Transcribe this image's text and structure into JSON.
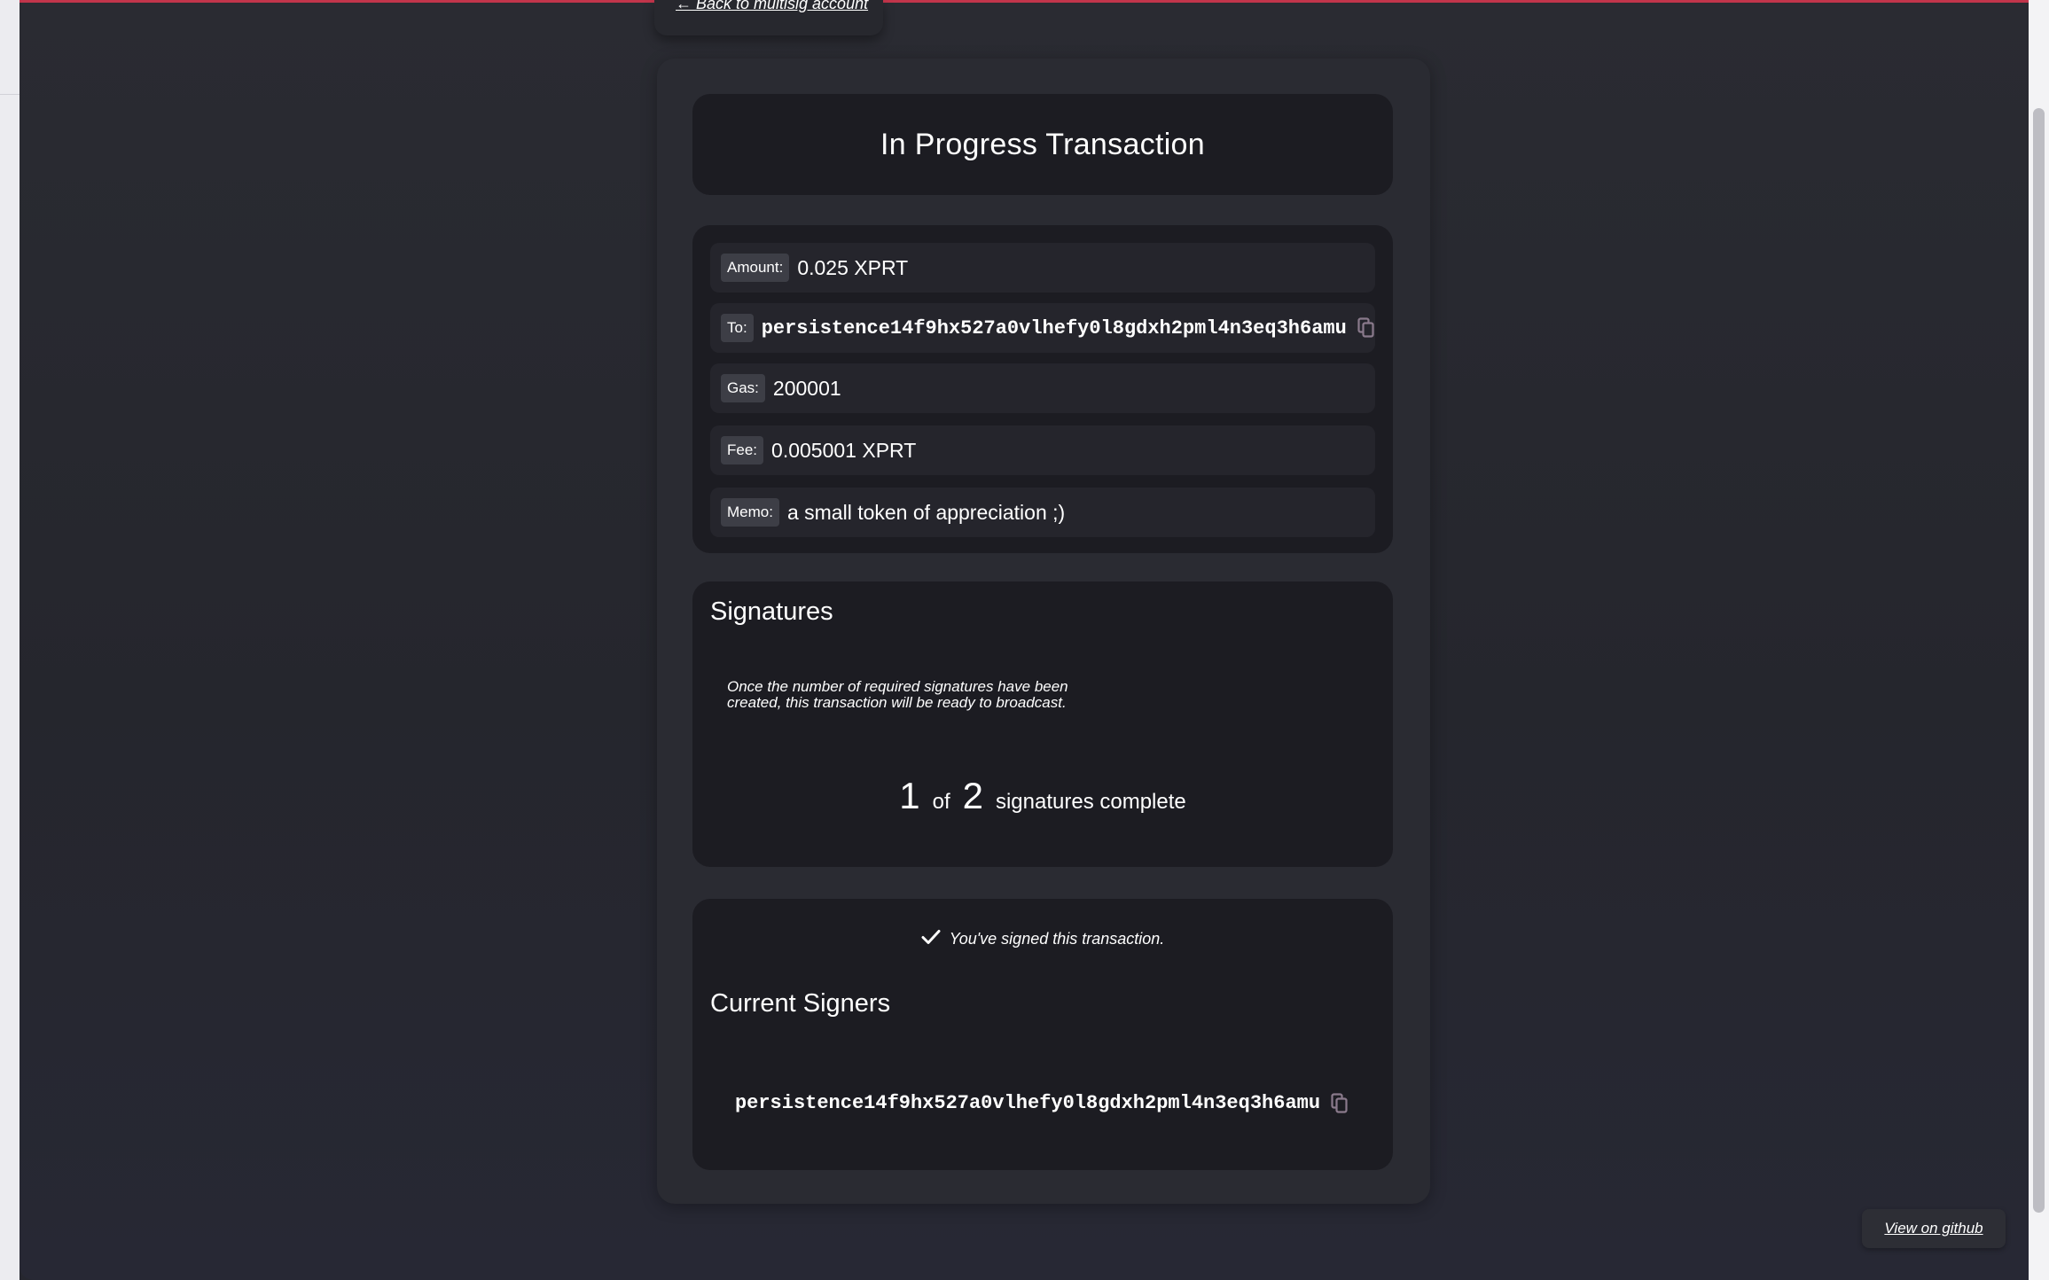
{
  "nav": {
    "back_label": "← Back to multisig account"
  },
  "title": "In Progress Transaction",
  "details": {
    "fields": [
      {
        "label": "Amount:",
        "value": "0.025 XPRT",
        "mono": false,
        "copyable": false
      },
      {
        "label": "To:",
        "value": "persistence14f9hx527a0vlhefy0l8gdxh2pml4n3eq3h6amu",
        "mono": true,
        "copyable": true
      },
      {
        "label": "Gas:",
        "value": "200001",
        "mono": false,
        "copyable": false
      },
      {
        "label": "Fee:",
        "value": "0.005001 XPRT",
        "mono": false,
        "copyable": false
      },
      {
        "label": "Memo:",
        "value": "a small token of appreciation ;)",
        "mono": false,
        "copyable": false
      }
    ]
  },
  "signatures": {
    "heading": "Signatures",
    "note": "Once the number of required signatures have been created, this transaction will be ready to broadcast.",
    "count": "1",
    "of_text": "of",
    "required": "2",
    "complete_text": "signatures complete"
  },
  "signers": {
    "signed_message": "You've signed this transaction.",
    "heading": "Current Signers",
    "list": [
      "persistence14f9hx527a0vlhefy0l8gdxh2pml4n3eq3h6amu"
    ]
  },
  "footer": {
    "github_label": "View on github"
  },
  "colors": {
    "accent": "#c2354b",
    "background": "#26272f",
    "card": "#1c1c22",
    "field_row": "#25252c",
    "label_chip": "#3d3e46",
    "copy_icon": "#8a7a8c"
  },
  "icons": {
    "copy": "copy-icon",
    "check": "checkmark-icon"
  }
}
